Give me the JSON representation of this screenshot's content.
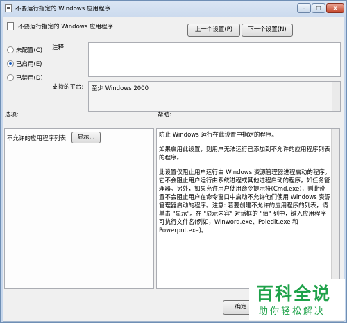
{
  "window": {
    "title": "不要运行指定的 Windows 应用程序",
    "min_symbol": "–",
    "max_symbol": "□",
    "close_symbol": "x"
  },
  "header": {
    "policy_name": "不要运行指定的 Windows 应用程序",
    "prev_button": "上一个设置(P)",
    "next_button": "下一个设置(N)"
  },
  "state": {
    "options": [
      {
        "label": "未配置(C)",
        "selected": false
      },
      {
        "label": "已启用(E)",
        "selected": true
      },
      {
        "label": "已禁用(D)",
        "selected": false
      }
    ]
  },
  "comment": {
    "label": "注释:",
    "value": ""
  },
  "platform": {
    "label": "支持的平台:",
    "value": "至少 Windows 2000"
  },
  "options_panel": {
    "label": "选项:",
    "list_label": "不允许的应用程序列表",
    "show_button": "显示..."
  },
  "help_panel": {
    "label": "帮助:",
    "paragraphs": [
      "防止 Windows 运行在此设置中指定的程序。",
      "如果启用此设置，则用户无法运行已添加到不允许的应用程序列表的程序。",
      "此设置仅阻止用户运行由 Windows 资源管理器进程启动的程序。它不会阻止用户运行由系统进程或其他进程启动的程序，如任务管理器。另外，如果允许用户使用命令提示符(Cmd.exe)，则此设置不会阻止用户在命令窗口中启动不允许他们使用 Windows 资源管理器启动的程序。注意: 若要创建不允许的应用程序的列表，请单击 \"显示\"。在 \"显示内容\" 对话框的 \"值\" 列中，键入应用程序可执行文件名(例如，Winword.exe、Poledit.exe 和 Powerpnt.exe)。"
    ]
  },
  "footer": {
    "ok_button": "确定"
  },
  "watermark": {
    "main": "百科全说",
    "sub": "助你轻松解决"
  },
  "colors": {
    "accent": "#1c5fbf",
    "watermark": "#1fa24a"
  }
}
